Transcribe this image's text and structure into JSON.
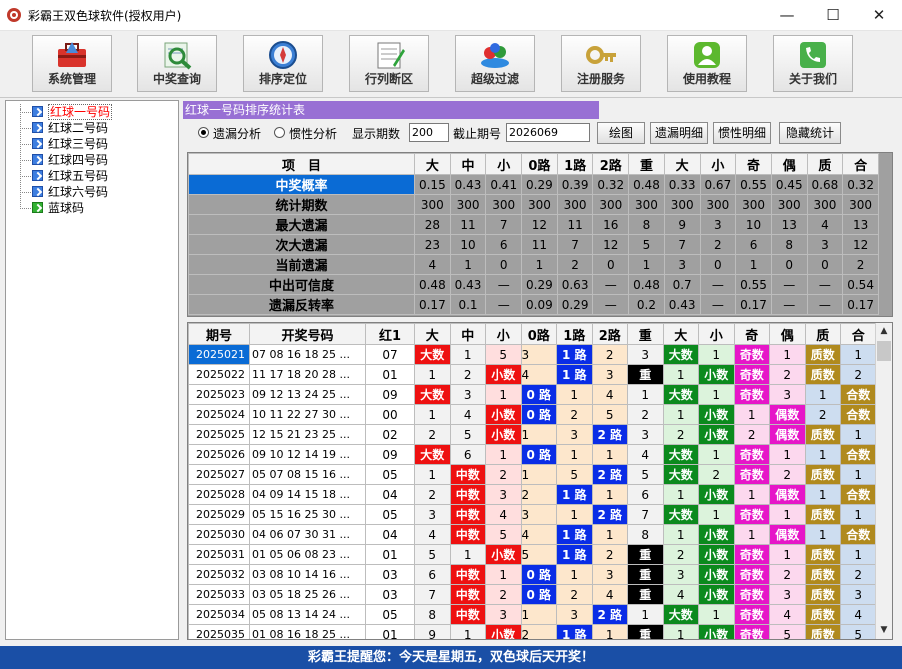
{
  "window": {
    "title": "彩霸王双色球软件(授权用户)"
  },
  "toolbar": [
    {
      "label": "系统管理",
      "icon": "toolbox-icon"
    },
    {
      "label": "中奖查询",
      "icon": "search-magnifier-icon"
    },
    {
      "label": "排序定位",
      "icon": "compass-icon"
    },
    {
      "label": "行列断区",
      "icon": "notepad-icon"
    },
    {
      "label": "超级过滤",
      "icon": "balls-icon"
    },
    {
      "label": "注册服务",
      "icon": "key-icon"
    },
    {
      "label": "使用教程",
      "icon": "user-icon"
    },
    {
      "label": "关于我们",
      "icon": "phone-icon"
    }
  ],
  "tree": {
    "items": [
      "红球一号码",
      "红球二号码",
      "红球三号码",
      "红球四号码",
      "红球五号码",
      "红球六号码",
      "蓝球码"
    ],
    "selected": 0
  },
  "section": {
    "title": "红球一号码排序统计表"
  },
  "controls": {
    "radio1": "遗漏分析",
    "radio2": "惯性分析",
    "periods_label": "显示期数",
    "periods_value": "200",
    "cutoff_label": "截止期号",
    "cutoff_value": "2026069",
    "buttons": [
      "绘图",
      "遗漏明细",
      "惯性明细",
      "隐藏统计"
    ]
  },
  "stats": {
    "header": [
      "项　目",
      "大",
      "中",
      "小",
      "0路",
      "1路",
      "2路",
      "重",
      "大",
      "小",
      "奇",
      "偶",
      "质",
      "合"
    ],
    "rows": [
      {
        "label": "中奖概率",
        "values": [
          "0.15",
          "0.43",
          "0.41",
          "0.29",
          "0.39",
          "0.32",
          "0.48",
          "0.33",
          "0.67",
          "0.55",
          "0.45",
          "0.68",
          "0.32"
        ]
      },
      {
        "label": "统计期数",
        "values": [
          "300",
          "300",
          "300",
          "300",
          "300",
          "300",
          "300",
          "300",
          "300",
          "300",
          "300",
          "300",
          "300"
        ]
      },
      {
        "label": "最大遗漏",
        "values": [
          "28",
          "11",
          "7",
          "12",
          "11",
          "16",
          "8",
          "9",
          "3",
          "10",
          "13",
          "4",
          "13"
        ]
      },
      {
        "label": "次大遗漏",
        "values": [
          "23",
          "10",
          "6",
          "11",
          "7",
          "12",
          "5",
          "7",
          "2",
          "6",
          "8",
          "3",
          "12"
        ]
      },
      {
        "label": "当前遗漏",
        "values": [
          "4",
          "1",
          "0",
          "1",
          "2",
          "0",
          "1",
          "3",
          "0",
          "1",
          "0",
          "0",
          "2"
        ]
      },
      {
        "label": "中出可信度",
        "values": [
          "0.48",
          "0.43",
          "—",
          "0.29",
          "0.63",
          "—",
          "0.48",
          "0.7",
          "—",
          "0.55",
          "—",
          "—",
          "0.54"
        ]
      },
      {
        "label": "遗漏反转率",
        "values": [
          "0.17",
          "0.1",
          "—",
          "0.09",
          "0.29",
          "—",
          "0.2",
          "0.43",
          "—",
          "0.17",
          "—",
          "—",
          "0.17"
        ]
      }
    ]
  },
  "history": {
    "header": [
      "期号",
      "开奖号码",
      "红1",
      "大",
      "中",
      "小",
      "0路",
      "1路",
      "2路",
      "重",
      "大",
      "小",
      "奇",
      "偶",
      "质",
      "合"
    ],
    "rows": [
      {
        "p": "2025021",
        "n": "07 08 16 18 25 ...",
        "r": "07",
        "c": [
          "大数",
          "1",
          "5",
          "3",
          "1 路",
          "2",
          "3",
          "大数",
          "1",
          "奇数",
          "1",
          "质数",
          "1"
        ]
      },
      {
        "p": "2025022",
        "n": "11 17 18 20 28 ...",
        "r": "01",
        "c": [
          "1",
          "2",
          "小数",
          "4",
          "1 路",
          "3",
          "重",
          "1",
          "小数",
          "奇数",
          "2",
          "质数",
          "2"
        ]
      },
      {
        "p": "2025023",
        "n": "09 12 13 24 25 ...",
        "r": "09",
        "c": [
          "大数",
          "3",
          "1",
          "0 路",
          "1",
          "4",
          "1",
          "大数",
          "1",
          "奇数",
          "3",
          "1",
          "合数"
        ]
      },
      {
        "p": "2025024",
        "n": "10 11 22 27 30 ...",
        "r": "00",
        "c": [
          "1",
          "4",
          "小数",
          "0 路",
          "2",
          "5",
          "2",
          "1",
          "小数",
          "1",
          "偶数",
          "2",
          "合数"
        ]
      },
      {
        "p": "2025025",
        "n": "12 15 21 23 25 ...",
        "r": "02",
        "c": [
          "2",
          "5",
          "小数",
          "1",
          "3",
          "2 路",
          "3",
          "2",
          "小数",
          "2",
          "偶数",
          "质数",
          "1"
        ]
      },
      {
        "p": "2025026",
        "n": "09 10 12 14 19 ...",
        "r": "09",
        "c": [
          "大数",
          "6",
          "1",
          "0 路",
          "1",
          "1",
          "4",
          "大数",
          "1",
          "奇数",
          "1",
          "1",
          "合数"
        ]
      },
      {
        "p": "2025027",
        "n": "05 07 08 15 16 ...",
        "r": "05",
        "c": [
          "1",
          "中数",
          "2",
          "1",
          "5",
          "2 路",
          "5",
          "大数",
          "2",
          "奇数",
          "2",
          "质数",
          "1"
        ]
      },
      {
        "p": "2025028",
        "n": "04 09 14 15 18 ...",
        "r": "04",
        "c": [
          "2",
          "中数",
          "3",
          "2",
          "1 路",
          "1",
          "6",
          "1",
          "小数",
          "1",
          "偶数",
          "1",
          "合数"
        ]
      },
      {
        "p": "2025029",
        "n": "05 15 16 25 30 ...",
        "r": "05",
        "c": [
          "3",
          "中数",
          "4",
          "3",
          "1",
          "2 路",
          "7",
          "大数",
          "1",
          "奇数",
          "1",
          "质数",
          "1"
        ]
      },
      {
        "p": "2025030",
        "n": "04 06 07 30 31 ...",
        "r": "04",
        "c": [
          "4",
          "中数",
          "5",
          "4",
          "1 路",
          "1",
          "8",
          "1",
          "小数",
          "1",
          "偶数",
          "1",
          "合数"
        ]
      },
      {
        "p": "2025031",
        "n": "01 05 06 08 23 ...",
        "r": "01",
        "c": [
          "5",
          "1",
          "小数",
          "5",
          "1 路",
          "2",
          "重",
          "2",
          "小数",
          "奇数",
          "1",
          "质数",
          "1"
        ]
      },
      {
        "p": "2025032",
        "n": "03 08 10 14 16 ...",
        "r": "03",
        "c": [
          "6",
          "中数",
          "1",
          "0 路",
          "1",
          "3",
          "重",
          "3",
          "小数",
          "奇数",
          "2",
          "质数",
          "2"
        ]
      },
      {
        "p": "2025033",
        "n": "03 05 18 25 26 ...",
        "r": "03",
        "c": [
          "7",
          "中数",
          "2",
          "0 路",
          "2",
          "4",
          "重",
          "4",
          "小数",
          "奇数",
          "3",
          "质数",
          "3"
        ]
      },
      {
        "p": "2025034",
        "n": "05 08 13 14 24 ...",
        "r": "05",
        "c": [
          "8",
          "中数",
          "3",
          "1",
          "3",
          "2 路",
          "1",
          "大数",
          "1",
          "奇数",
          "4",
          "质数",
          "4"
        ]
      },
      {
        "p": "2025035",
        "n": "01 08 16 18 25 ...",
        "r": "01",
        "c": [
          "9",
          "1",
          "小数",
          "2",
          "1 路",
          "1",
          "重",
          "1",
          "小数",
          "奇数",
          "5",
          "质数",
          "5"
        ]
      }
    ]
  },
  "status": "彩霸王提醒您：今天是星期五，双色球后天开奖！",
  "colors": {
    "accent_purple": "#9870d4",
    "status_blue": "#1a4fa6",
    "selection_blue": "#0a6bd5"
  }
}
